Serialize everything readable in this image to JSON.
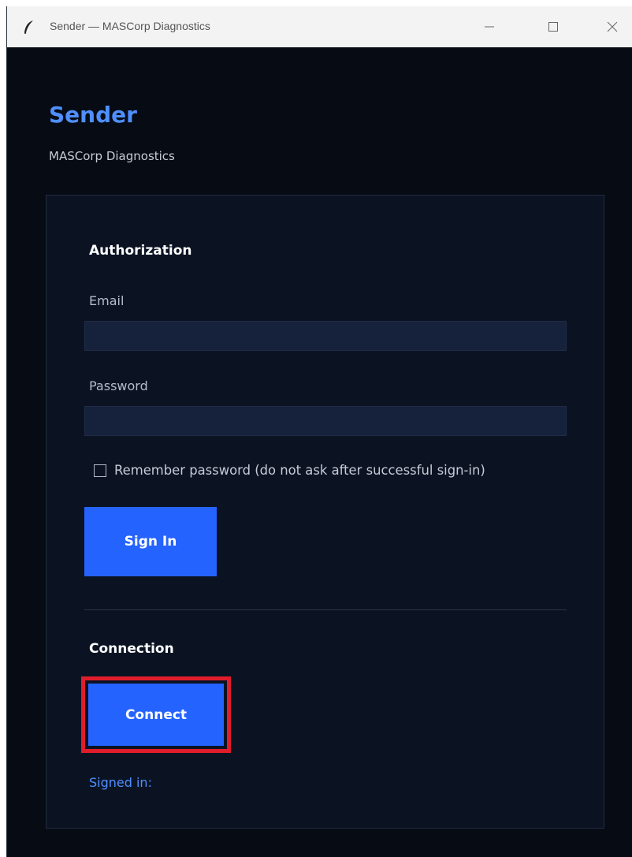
{
  "window": {
    "title": "Sender — MASCorp Diagnostics",
    "icons": {
      "app": "feather-icon",
      "minimize": "minimize-icon",
      "maximize": "maximize-icon",
      "close": "close-icon"
    }
  },
  "header": {
    "title": "Sender",
    "subtitle": "MASCorp Diagnostics"
  },
  "authorization": {
    "title": "Authorization",
    "email_label": "Email",
    "email_value": "",
    "password_label": "Password",
    "password_value": "",
    "remember_label": "Remember password (do not ask after successful sign-in)",
    "remember_checked": false,
    "signin_label": "Sign In"
  },
  "connection": {
    "title": "Connection",
    "connect_label": "Connect",
    "status_text": "Signed in:"
  },
  "colors": {
    "background": "#070b14",
    "panel": "#0b1323",
    "accent": "#4f8fff",
    "button": "#2563ff",
    "highlight": "#e11d2b"
  }
}
